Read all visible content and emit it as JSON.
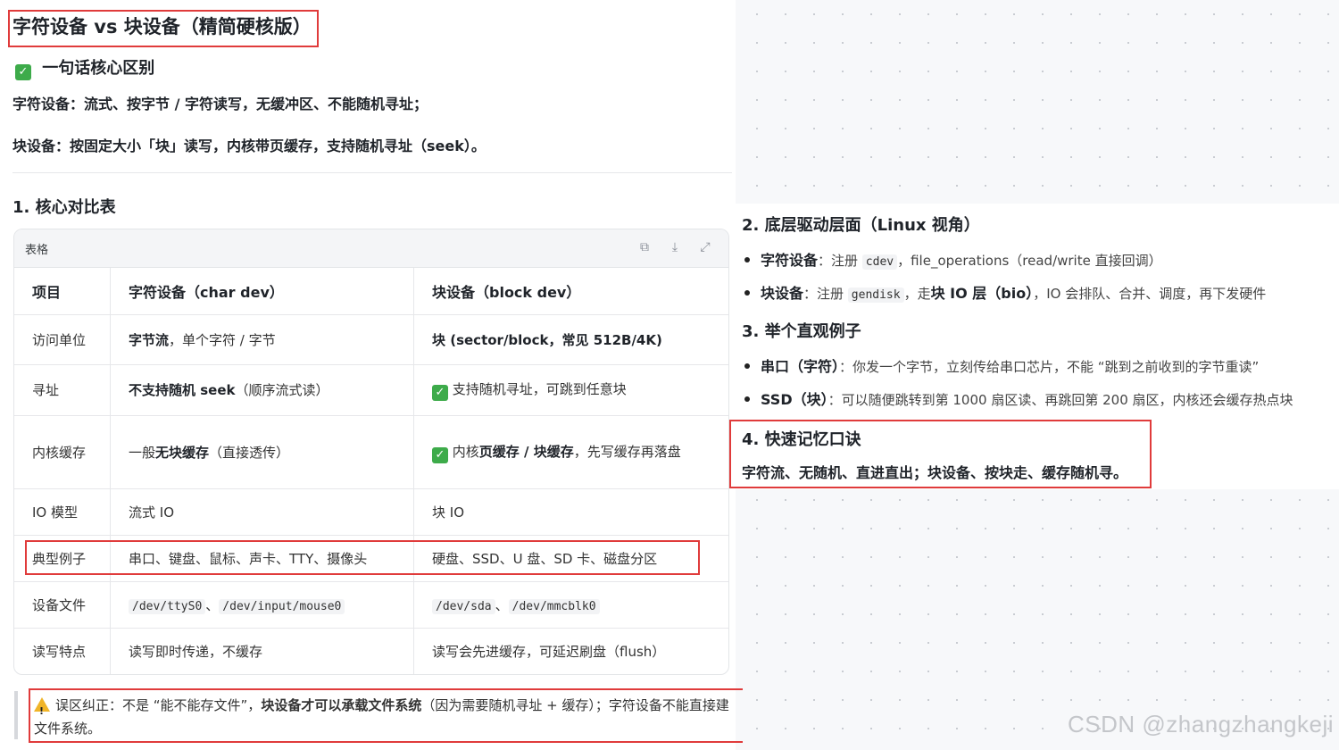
{
  "title": "字符设备 vs 块设备（精简硬核版）",
  "summary": {
    "heading": "一句话核心区别",
    "char_line": "字符设备：流式、按字节 / 字符读写，无缓冲区、不能随机寻址；",
    "block_line": "块设备：按固定大小「块」读写，内核带页缓存，支持随机寻址（seek）。"
  },
  "section1": {
    "heading": "1. 核心对比表",
    "card_label": "表格",
    "columns": [
      "项目",
      "字符设备（char dev）",
      "块设备（block dev）"
    ],
    "rows": [
      {
        "item": "访问单位",
        "char_b": "字节流",
        "char_rest": "，单个字符 / 字节",
        "block_b": "块 (sector/block，常见 512B/4K)",
        "block_rest": ""
      },
      {
        "item": "寻址",
        "char_b": "不支持随机 seek",
        "char_rest": "（顺序流式读）",
        "block_b": "",
        "block_rest": "支持随机寻址，可跳到任意块"
      },
      {
        "item": "内核缓存",
        "char_pre": "一般",
        "char_b": "无块缓存",
        "char_rest": "（直接透传）",
        "block_pre": "内核",
        "block_b": "页缓存 / 块缓存",
        "block_rest": "，先写缓存再落盘"
      },
      {
        "item": "IO 模型",
        "char_rest": "流式 IO",
        "block_rest": "块 IO"
      },
      {
        "item": "典型例子",
        "char_rest": "串口、键盘、鼠标、声卡、TTY、摄像头",
        "block_rest": "硬盘、SSD、U 盘、SD 卡、磁盘分区"
      },
      {
        "item": "设备文件",
        "char_code1": "/dev/ttyS0",
        "char_code2": "/dev/input/mouse0",
        "block_code1": "/dev/sda",
        "block_code2": "/dev/mmcblk0",
        "sep": "、"
      },
      {
        "item": "读写特点",
        "char_rest": "读写即时传递，不缓存",
        "block_rest": "读写会先进缓存，可延迟刷盘（flush）"
      }
    ]
  },
  "warning": {
    "prefix": "误区纠正：不是 “能不能存文件”，",
    "bold": "块设备才可以承载文件系统",
    "suffix": "（因为需要随机寻址 + 缓存）；字符设备不能直接建文件系统。"
  },
  "section2": {
    "heading": "2. 底层驱动层面（Linux 视角）",
    "items": [
      {
        "bold": "字符设备",
        "pre": "：注册 ",
        "code": "cdev",
        "post": "，file_operations（read/write 直接回调）"
      },
      {
        "bold": "块设备",
        "pre": "：注册 ",
        "code": "gendisk",
        "post": "，走",
        "bold2": "块 IO 层（bio）",
        "post2": "，IO 会排队、合并、调度，再下发硬件"
      }
    ]
  },
  "section3": {
    "heading": "3. 举个直观例子",
    "items": [
      {
        "bold": "串口（字符）",
        "text": "：你发一个字节，立刻传给串口芯片，不能 “跳到之前收到的字节重读”"
      },
      {
        "bold": "SSD（块）",
        "text": "：可以随便跳转到第 1000 扇区读、再跳回第 200 扇区，内核还会缓存热点块"
      }
    ]
  },
  "section4": {
    "heading": "4. 快速记忆口诀",
    "mnemonic": "字符流、无随机、直进直出；块设备、按块走、缓存随机寻。"
  },
  "watermark": "CSDN @zhangzhangkeji",
  "icons": {
    "check": "check-icon",
    "warning": "warning-icon",
    "copy": "copy-icon",
    "download": "download-icon",
    "expand": "expand-icon"
  },
  "colors": {
    "highlight_border": "#e03b3b",
    "check_green": "#3dab4a",
    "warning_yellow": "#f0b429"
  }
}
